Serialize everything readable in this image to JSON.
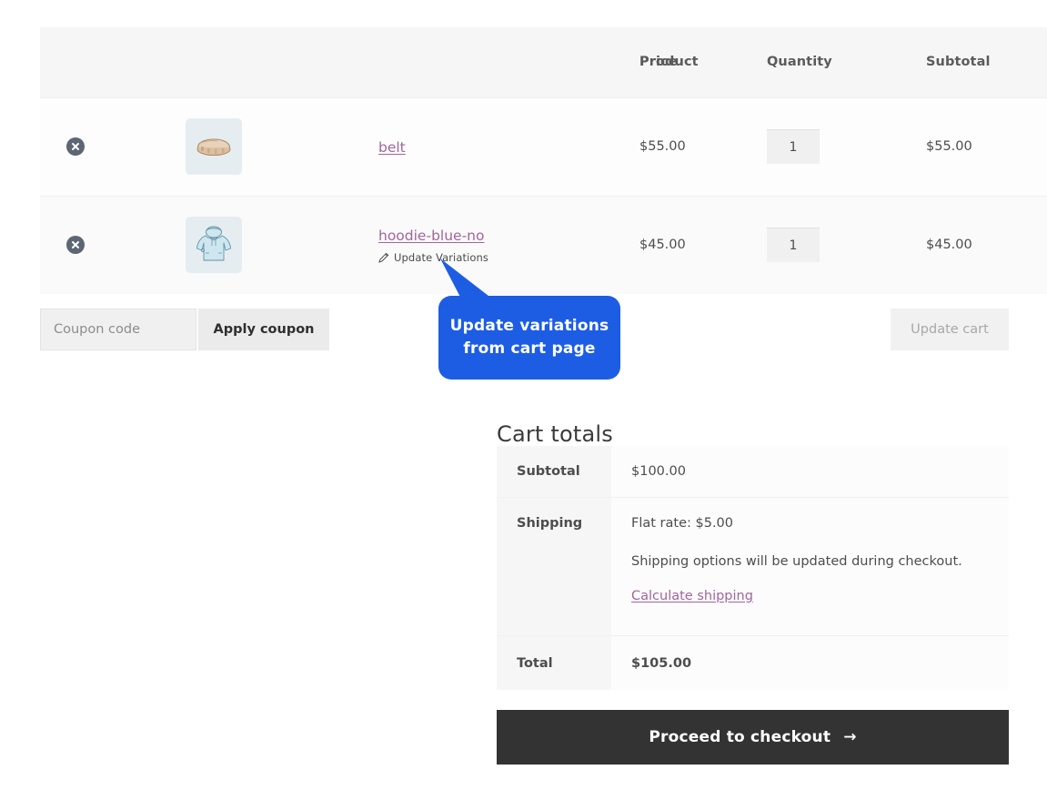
{
  "cart_table": {
    "columns": [
      "",
      "",
      "Product",
      "Price",
      "Quantity",
      "Subtotal"
    ],
    "headers": {
      "product": "Product",
      "price": "Price",
      "quantity": "Quantity",
      "subtotal": "Subtotal"
    },
    "rows": [
      {
        "remove_label": "×",
        "thumbnail_icon": "belt-product-thumbnail",
        "name": "belt",
        "price": "$55.00",
        "quantity": "1",
        "subtotal": "$55.00",
        "has_variations_link": false,
        "variations_label": ""
      },
      {
        "remove_label": "×",
        "thumbnail_icon": "hoodie-product-thumbnail",
        "name": "hoodie-blue-no",
        "price": "$45.00",
        "quantity": "1",
        "subtotal": "$45.00",
        "has_variations_link": true,
        "variations_label": "Update Variations"
      }
    ]
  },
  "coupon": {
    "placeholder": "Coupon code",
    "value": "",
    "apply_label": "Apply coupon",
    "update_cart_label": "Update cart"
  },
  "callout": {
    "line1": "Update variations",
    "line2": "from cart page",
    "color": "#1d5de4"
  },
  "cart_totals": {
    "title": "Cart totals",
    "subtotal_label": "Subtotal",
    "subtotal_value": "$100.00",
    "shipping_label": "Shipping",
    "shipping_rate": "Flat rate: $5.00",
    "shipping_note": "Shipping options will be updated during checkout.",
    "calculate_shipping_link": "Calculate shipping",
    "total_label": "Total",
    "total_value": "$105.00"
  },
  "checkout": {
    "label": "Proceed to checkout",
    "arrow": "→"
  },
  "colors": {
    "link": "#a1669b",
    "callout_blue": "#1d5de4",
    "checkout_bg": "#333333",
    "header_bg": "#f6f6f6"
  }
}
